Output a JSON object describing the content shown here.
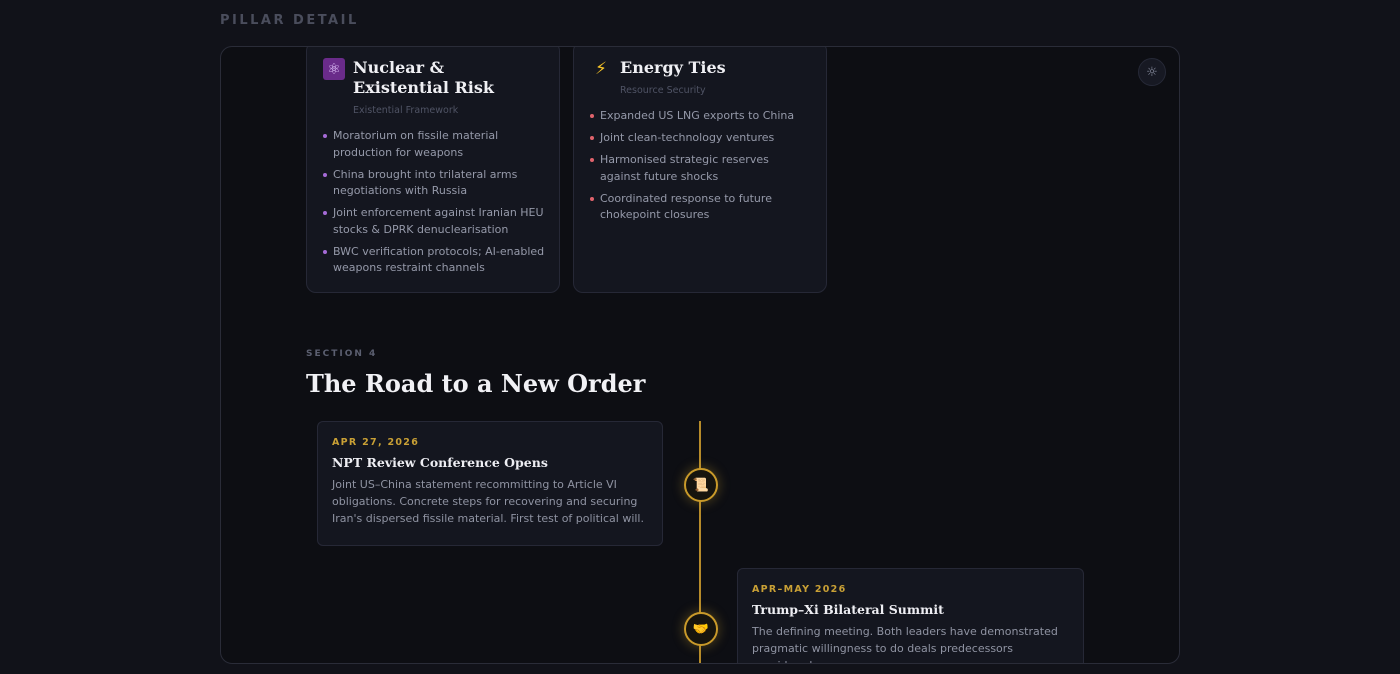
{
  "page": {
    "label": "PILLAR DETAIL"
  },
  "theme_toggle": {
    "icon": "sun-icon",
    "glyph": "☼"
  },
  "cards": [
    {
      "title": "Nuclear & Existential Risk",
      "subtitle": "Existential Framework",
      "icon": "atom-icon",
      "glyph": "⚛",
      "accent": "#a56ad6",
      "bullets": [
        "Moratorium on fissile material production for weapons",
        "China brought into trilateral arms negotiations with Russia",
        "Joint enforcement against Iranian HEU stocks & DPRK denuclearisation",
        "BWC verification protocols; AI-enabled weapons restraint channels"
      ]
    },
    {
      "title": "Energy Ties",
      "subtitle": "Resource Security",
      "icon": "lightning-bolt-icon",
      "glyph": "⚡",
      "accent": "#e0636c",
      "bullets": [
        "Expanded US LNG exports to China",
        "Joint clean-technology ventures",
        "Harmonised strategic reserves against future shocks",
        "Coordinated response to future chokepoint closures"
      ]
    }
  ],
  "section": {
    "kicker": "SECTION 4",
    "title": "The Road to a New Order"
  },
  "timeline": {
    "accent": "#c9a035",
    "events": [
      {
        "date": "APR 27, 2026",
        "title": "NPT Review Conference Opens",
        "description": "Joint US–China statement recommitting to Article VI obligations. Concrete steps for recovering and securing Iran's dispersed fissile material. First test of political will.",
        "icon": "scroll-icon",
        "glyph": "📜"
      },
      {
        "date": "APR–MAY 2026",
        "title": "Trump–Xi Bilateral Summit",
        "description": "The defining meeting. Both leaders have demonstrated pragmatic willingness to do deals predecessors considered",
        "icon": "handshake-icon",
        "glyph": "🤝"
      }
    ]
  }
}
